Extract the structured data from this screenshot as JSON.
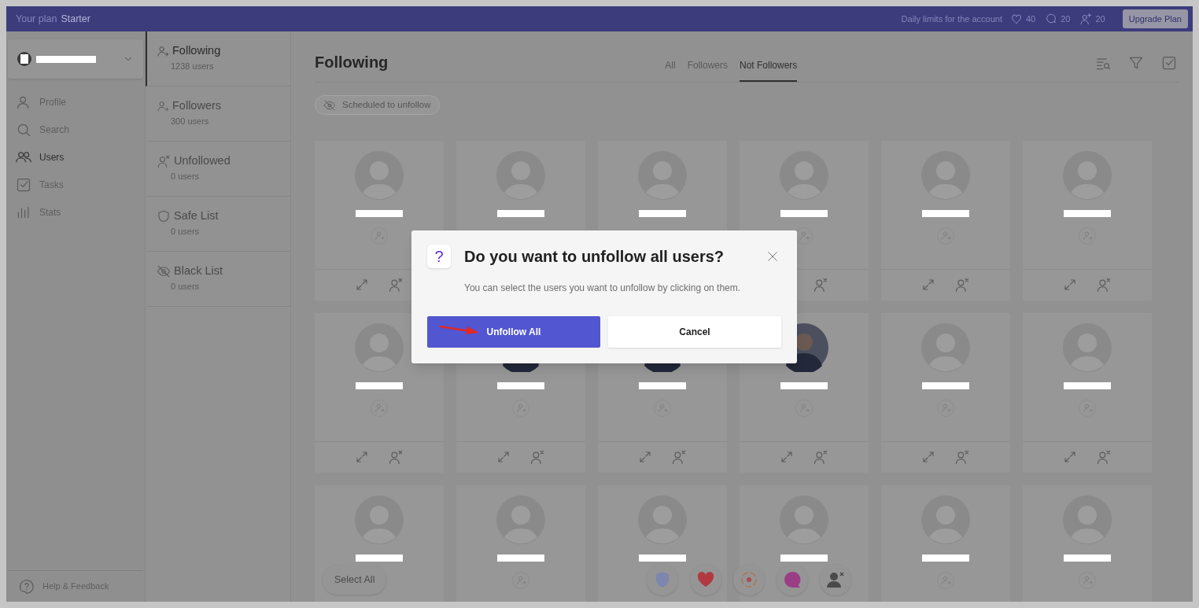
{
  "top_bar": {
    "plan_label": "Your plan",
    "plan": "Starter",
    "limits_label": "Daily limits for the account",
    "limits": [
      {
        "kind": "likes",
        "count": "40"
      },
      {
        "kind": "comments",
        "count": "20"
      },
      {
        "kind": "follows",
        "count": "20"
      }
    ],
    "upgrade_button": "Upgrade Plan"
  },
  "sidebar": {
    "nav": [
      {
        "kind": "profile",
        "label": "Profile",
        "selected": false
      },
      {
        "kind": "search",
        "label": "Search",
        "selected": false
      },
      {
        "kind": "users",
        "label": "Users",
        "selected": true
      },
      {
        "kind": "tasks",
        "label": "Tasks",
        "selected": false
      },
      {
        "kind": "stats",
        "label": "Stats",
        "selected": false
      }
    ],
    "help": "Help & Feedback"
  },
  "lists": [
    {
      "kind": "following",
      "title": "Following",
      "count": "1238 users",
      "selected": true
    },
    {
      "kind": "followers",
      "title": "Followers",
      "count": "300 users",
      "selected": false
    },
    {
      "kind": "unfollowed",
      "title": "Unfollowed",
      "count": "0 users",
      "selected": false
    },
    {
      "kind": "safe",
      "title": "Safe List",
      "count": "0 users",
      "selected": false
    },
    {
      "kind": "black",
      "title": "Black List",
      "count": "0 users",
      "selected": false
    }
  ],
  "main": {
    "title": "Following",
    "tabs": [
      {
        "label": "All",
        "selected": false
      },
      {
        "label": "Followers",
        "selected": false
      },
      {
        "label": "Not Followers",
        "selected": true
      }
    ],
    "chip": "Scheduled to unfollow",
    "cards": [
      {
        "photo": false
      },
      {
        "photo": false
      },
      {
        "photo": false
      },
      {
        "photo": false
      },
      {
        "photo": false
      },
      {
        "photo": false
      },
      {
        "photo": false
      },
      {
        "photo": true
      },
      {
        "photo": true
      },
      {
        "photo": true
      },
      {
        "photo": false
      },
      {
        "photo": false
      },
      {
        "photo": false
      },
      {
        "photo": false
      },
      {
        "photo": false
      },
      {
        "photo": false
      },
      {
        "photo": false
      },
      {
        "photo": false
      }
    ],
    "select_all": "Select All",
    "actions": [
      {
        "kind": "shield"
      },
      {
        "kind": "heart"
      },
      {
        "kind": "target"
      },
      {
        "kind": "chat"
      },
      {
        "kind": "user-remove"
      }
    ]
  },
  "dialog": {
    "icon": "?",
    "title": "Do you want to unfollow all users?",
    "message": "You can select the users you want to unfollow by clicking on them.",
    "buttons": [
      {
        "kind": "primary",
        "label": "Unfollow All"
      },
      {
        "kind": "secondary",
        "label": "Cancel"
      }
    ]
  }
}
